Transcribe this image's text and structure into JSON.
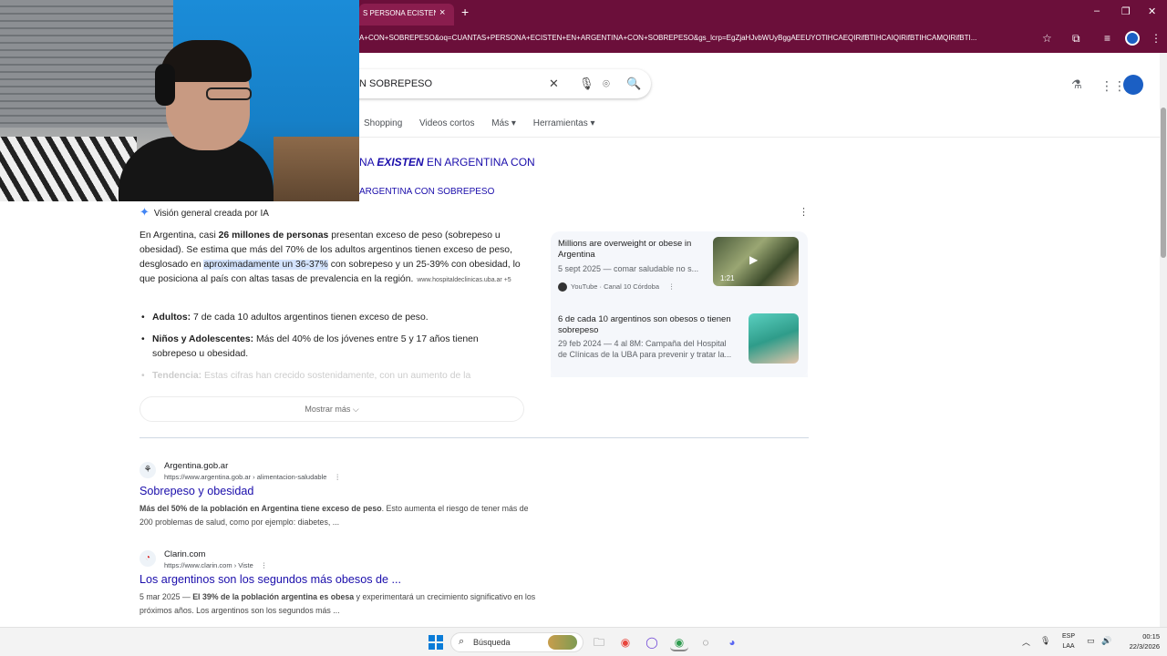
{
  "browser": {
    "tab_title": "S PERSONA ECISTEN E",
    "tab_close": "×",
    "new_tab": "+",
    "url": "A+CON+SOBREPESO&oq=CUANTAS+PERSONA+ECISTEN+EN+ARGENTINA+CON+SOBREPESO&gs_lcrp=EgZjaHJvbWUyBggAEEUYOTIHCAEQIRifBTIHCAIQIRifBTIHCAMQIRifBTI...",
    "window_min": "–",
    "window_max": "❐",
    "window_close": "✕",
    "icons": {
      "star": "☆",
      "extensions": "⧉",
      "media": "≡",
      "menu": "⋮"
    }
  },
  "search": {
    "query": "N SOBREPESO",
    "clear": "✕",
    "mic": "🎙",
    "lens": "⌾",
    "submit": "🔍"
  },
  "header_icons": {
    "labs": "⚗",
    "apps": "⋮⋮"
  },
  "filters": [
    "Shopping",
    "Videos cortos",
    "Más ▾",
    "Herramientas ▾"
  ],
  "spelling": {
    "line1_prefix": "NA ",
    "line1_bold": "EXISTEN",
    "line1_suffix": " EN ARGENTINA CON",
    "line2": "ARGENTINA CON SOBREPESO"
  },
  "ai_overview": {
    "header": "Visión general creada por IA",
    "spark": "✦",
    "more": "⋮",
    "p_a": "En Argentina, casi ",
    "p_b": "26 millones de personas",
    "p_c": " presentan exceso de peso (sobrepeso u obesidad). Se estima que más del 70% de los adultos argentinos tienen exceso de peso, desglosado en ",
    "p_d": "aproximadamente un 36-37%",
    "p_e": " con sobrepeso y un 25-39% con obesidad, lo que posiciona al país con altas tasas de prevalencia en la región.",
    "cite": "www.hospitaldeclinicas.uba.ar +5",
    "items": [
      {
        "label": "Adultos:",
        "text": " 7 de cada 10 adultos argentinos tienen exceso de peso."
      },
      {
        "label": "Niños y Adolescentes:",
        "text": " Más del 40% de los jóvenes entre 5 y 17 años tienen sobrepeso u obesidad."
      },
      {
        "label": "Tendencia:",
        "text": " Estas cifras han crecido sostenidamente, con un aumento de la"
      }
    ],
    "show_more": "Mostrar más ⌵"
  },
  "videos": [
    {
      "title": "Millions are overweight or obese in Argentina",
      "meta": "5 sept 2025 — comar saludable no s...",
      "source": "YouTube · Canal 10 Córdoba",
      "more": "⋮",
      "duration": "1:21",
      "play": "▶"
    },
    {
      "title": "6 de cada 10 argentinos son obesos o tienen sobrepeso",
      "meta1": "29 feb 2024 — 4 al 8M: Campaña del Hospital",
      "meta2": "de Clínicas de la UBA para prevenir y tratar la..."
    }
  ],
  "results": [
    {
      "favicon": "⚘",
      "site": "Argentina.gob.ar",
      "url": "https://www.argentina.gob.ar › alimentacion-saludable",
      "more": "⋮",
      "title": "Sobrepeso y obesidad",
      "snippet_bold": "Más del 50% de la población en Argentina tiene exceso de peso",
      "snippet": ". Esto aumenta el riesgo de tener más de 200 problemas de salud, como por ejemplo: diabetes, ..."
    },
    {
      "favicon": "◔",
      "site": "Clarin.com",
      "url": "https://www.clarin.com › Viste",
      "more": "⋮",
      "title": "Los argentinos son los segundos más obesos de ...",
      "snippet_date": "5 mar 2025 — ",
      "snippet_bold": "El 39% de la población argentina es obesa",
      "snippet": " y experimentará un crecimiento significativo en los próximos años. Los argentinos son los segundos más ..."
    }
  ],
  "taskbar": {
    "search_placeholder": "Búsqueda",
    "search_icon": "⌕",
    "apps": [
      "🗀",
      "◉",
      "◯",
      "◉",
      "◌",
      "◕"
    ],
    "lang1": "ESP",
    "lang2": "LAA",
    "time": "00:15",
    "date": "22/3/2026",
    "tray_up": "︿",
    "tray_mic": "🎙",
    "tray_net": "▭",
    "tray_vol": "🔊"
  },
  "colors": {
    "chrome_bar": "#6b0f3a",
    "link": "#1a0dab",
    "highlight": "#d3e3fd"
  }
}
